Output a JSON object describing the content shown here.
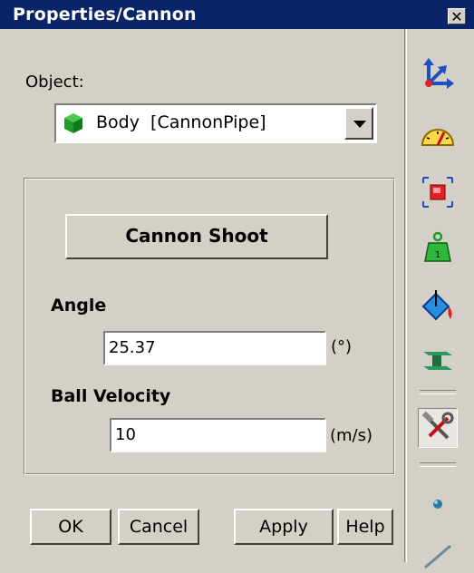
{
  "window": {
    "title": "Properties/Cannon",
    "close_glyph": "✕"
  },
  "object": {
    "label": "Object:",
    "selected": "Body  [CannonPipe]",
    "icon": "green-cube-icon"
  },
  "group": {
    "shoot_button": "Cannon Shoot",
    "angle_label": "Angle",
    "angle_value": "25.37",
    "angle_unit": "(°)",
    "velocity_label": "Ball Velocity",
    "velocity_value": "10",
    "velocity_unit": "(m/s)"
  },
  "buttons": {
    "ok": "OK",
    "cancel": "Cancel",
    "apply": "Apply",
    "help": "Help"
  },
  "toolbar": {
    "tools": [
      "axes-icon",
      "speedometer-icon",
      "selection-box-icon",
      "mass-weight-icon",
      "paint-bucket-icon",
      "i-beam-icon",
      "tools-hammer-wrench-icon",
      "point-icon",
      "pen-icon"
    ],
    "colors": {
      "accent_blue": "#0a246a",
      "cube_green": "#1f9a2c",
      "gauge_yellow": "#ffd84a",
      "red": "#e0202a"
    }
  }
}
